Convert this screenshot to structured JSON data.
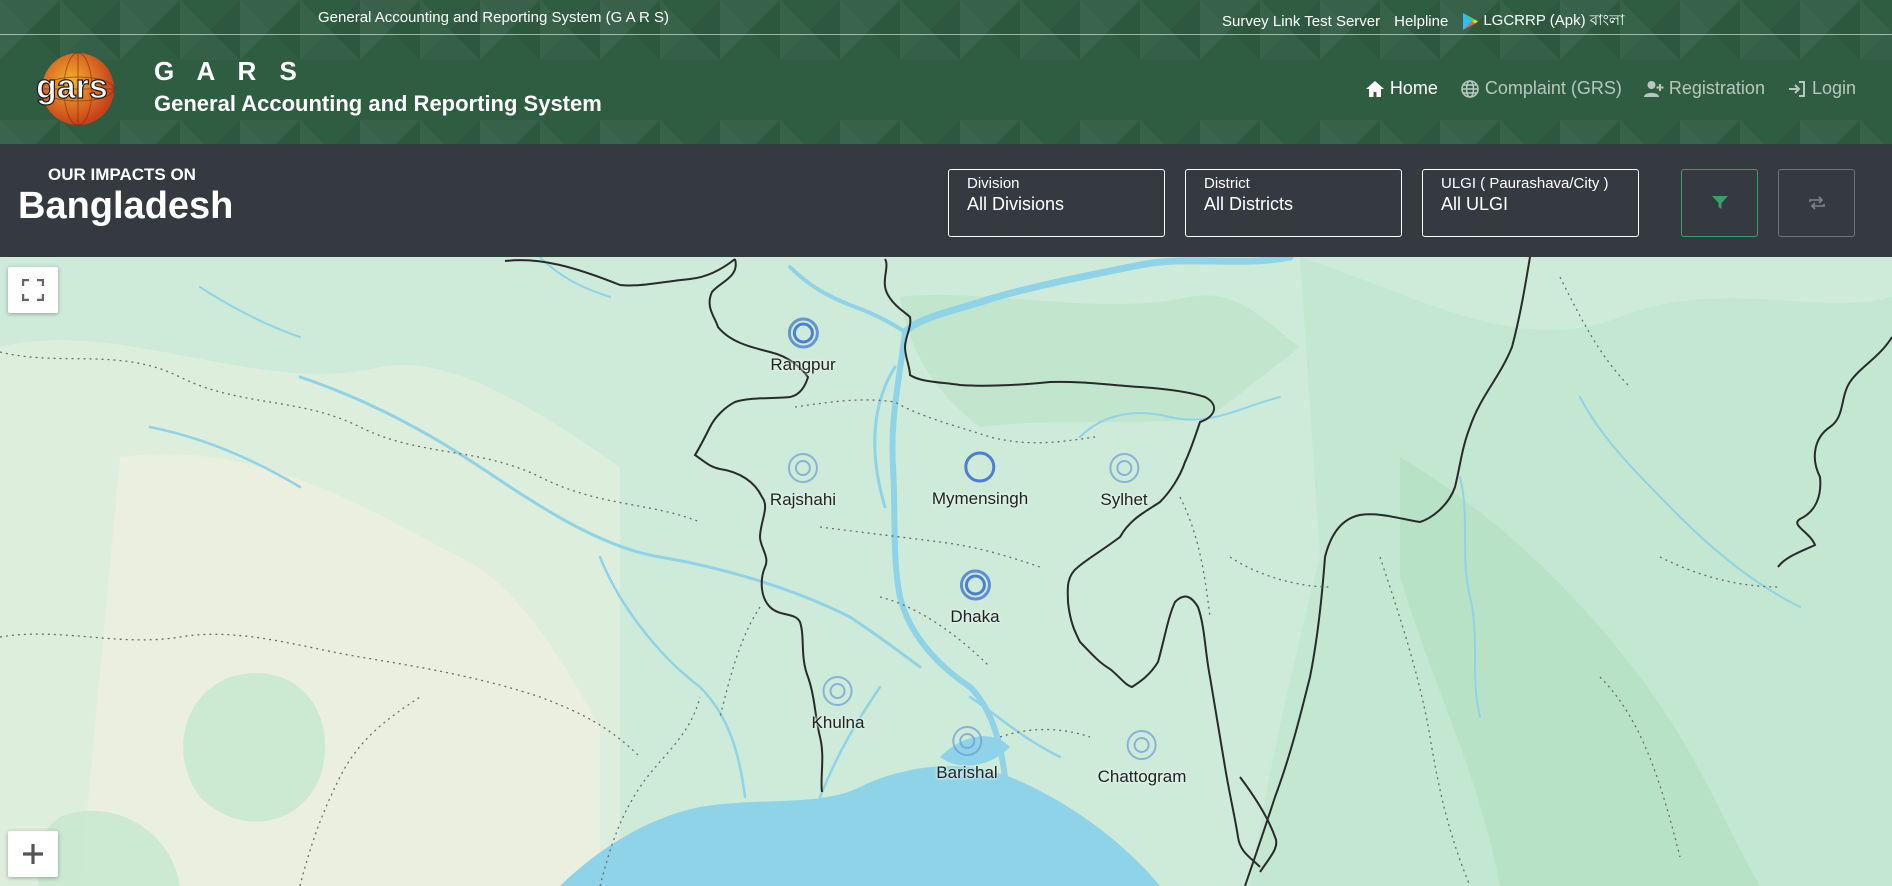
{
  "topbar": {
    "system_name": "General Accounting and Reporting System (G A R S)",
    "survey_link": "Survey Link Test Server",
    "helpline": "Helpline",
    "apk_link": "LGCRRP (Apk) বাংলা"
  },
  "brand": {
    "logo_text": "gars",
    "abbr": "G A R S",
    "full_name": "General Accounting and Reporting System"
  },
  "nav": {
    "home": "Home",
    "complaint": "Complaint (GRS)",
    "registration": "Registration",
    "login": "Login"
  },
  "filter": {
    "impacts_label": "OUR IMPACTS ON",
    "country": "Bangladesh",
    "division": {
      "label": "Division",
      "value": "All Divisions"
    },
    "district": {
      "label": "District",
      "value": "All Districts"
    },
    "ulgi": {
      "label": "ULGI ( Paurashava/City )",
      "value": "All ULGI"
    }
  },
  "map": {
    "markers": [
      "Rangpur",
      "Rajshahi",
      "Mymensingh",
      "Sylhet",
      "Dhaka",
      "Khulna",
      "Barishal",
      "Chattogram"
    ]
  },
  "colors": {
    "header_green": "#2f5d42",
    "filter_bar": "#343a40",
    "marker_blue": "#4a7fd4",
    "water": "#8fd3e8"
  }
}
